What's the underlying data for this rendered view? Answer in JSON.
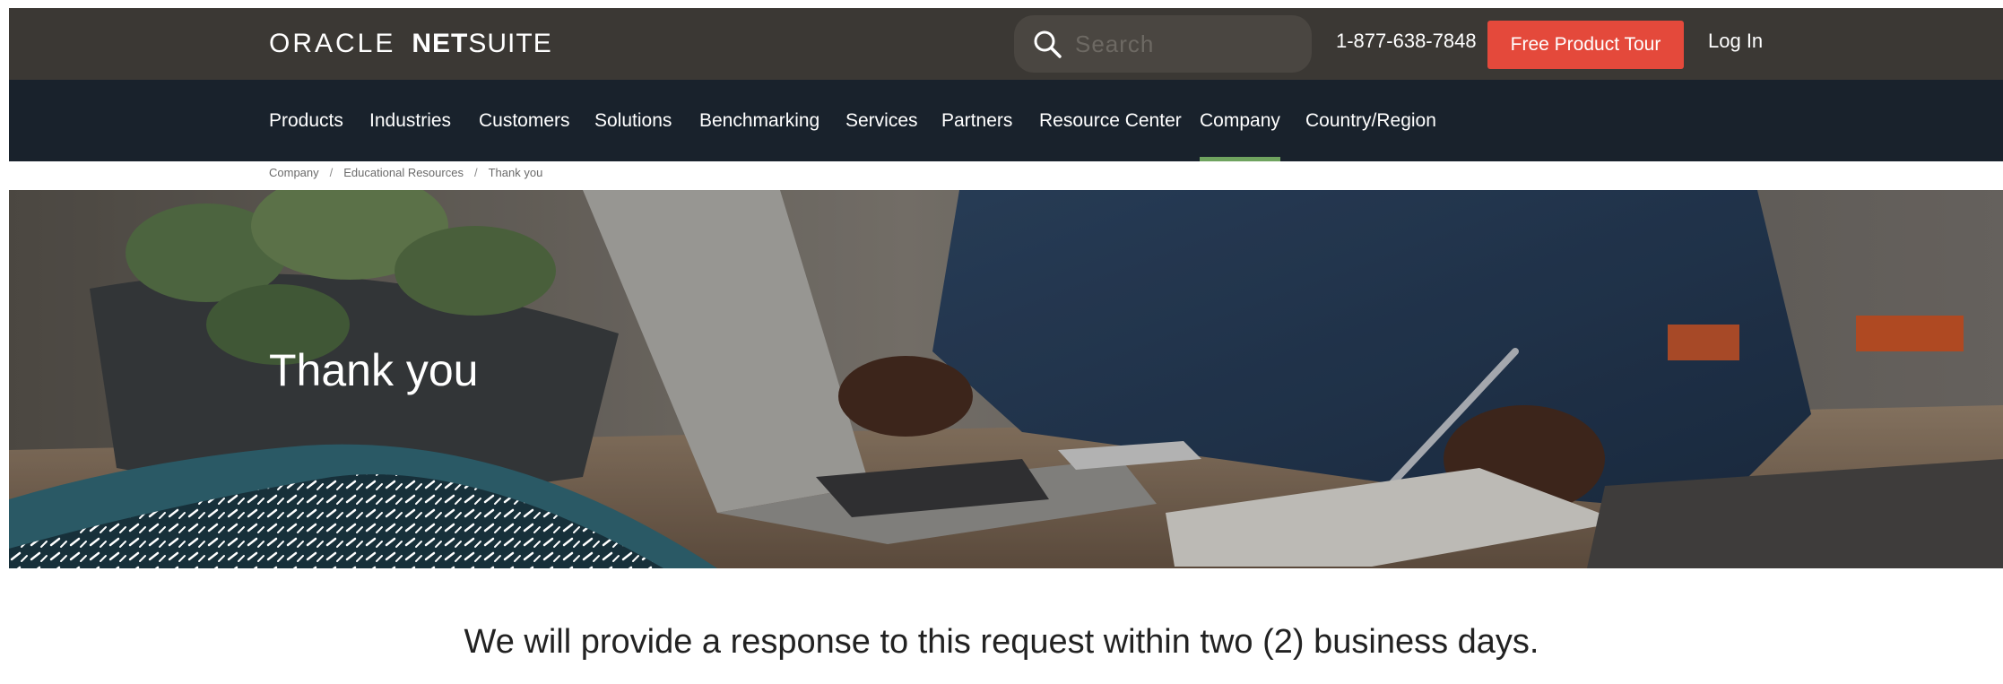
{
  "header": {
    "logo": {
      "oracle": "ORACLE",
      "net": "NET",
      "suite": "SUITE"
    },
    "search": {
      "placeholder": "Search",
      "icon": "search-icon"
    },
    "phone": "1-877-638-7848",
    "tour_button": "Free Product Tour",
    "login": "Log In"
  },
  "nav": {
    "items": [
      {
        "label": "Products",
        "active": false
      },
      {
        "label": "Industries",
        "active": false
      },
      {
        "label": "Customers",
        "active": false
      },
      {
        "label": "Solutions",
        "active": false
      },
      {
        "label": "Benchmarking",
        "active": false
      },
      {
        "label": "Services",
        "active": false
      },
      {
        "label": "Partners",
        "active": false
      },
      {
        "label": "Resource Center",
        "active": false
      },
      {
        "label": "Company",
        "active": true
      },
      {
        "label": "Country/Region",
        "active": false
      }
    ]
  },
  "breadcrumb": [
    "Company",
    "Educational Resources",
    "Thank you"
  ],
  "hero": {
    "title": "Thank you"
  },
  "message": "We will provide a response to this request within two (2) business days.",
  "colors": {
    "topbar": "#3b3834",
    "navbar": "#19222c",
    "accent_red": "#e4493b",
    "active_underline": "#6fa35f"
  }
}
